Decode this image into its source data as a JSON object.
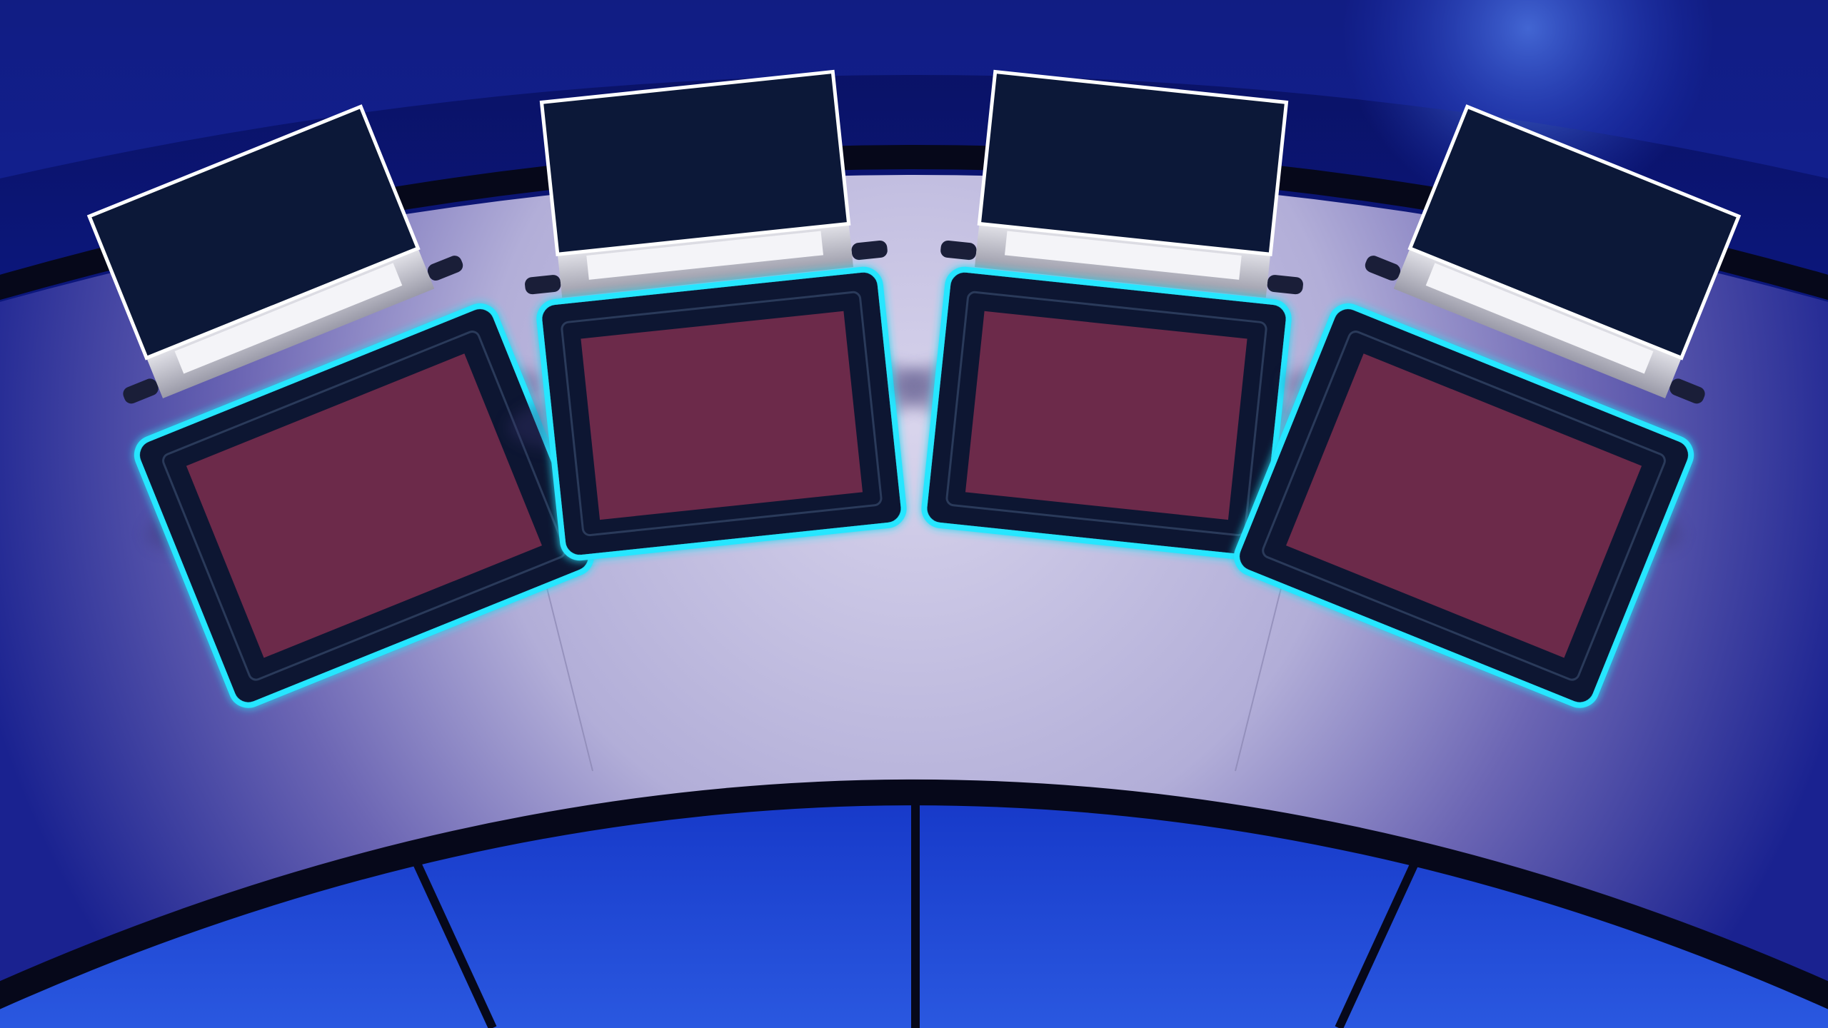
{
  "scene": {
    "name": "contestant-podium-stage",
    "podium_count": 4
  },
  "colors": {
    "background_deep": "#050a3a",
    "background_blue": "#1a35c8",
    "floor_light": "#d8d6ec",
    "floor_shadow": "#8c88b8",
    "rail_dark": "#060818",
    "monitor_screen": "#0c1838",
    "monitor_frame": "#ffffff",
    "monitor_base": "#c8c8d0",
    "monitor_bar": "#f0f0f4",
    "panel_glow": "#25e6ff",
    "panel_dark": "#0c1630",
    "panel_face": "#6c2a4a"
  },
  "podiums": [
    {
      "id": "podium-1",
      "player_name": "",
      "score": ""
    },
    {
      "id": "podium-2",
      "player_name": "",
      "score": ""
    },
    {
      "id": "podium-3",
      "player_name": "",
      "score": ""
    },
    {
      "id": "podium-4",
      "player_name": "",
      "score": ""
    }
  ]
}
